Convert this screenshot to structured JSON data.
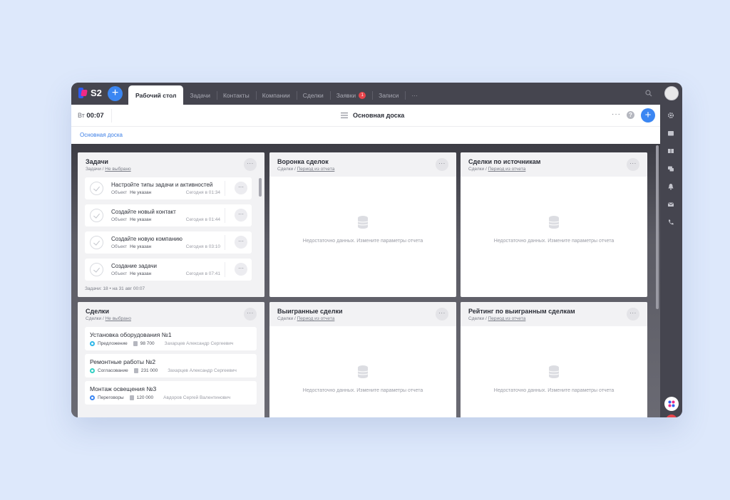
{
  "app": {
    "logo_text": "S2",
    "plus_label": "+",
    "tabs": [
      {
        "label": "Рабочий стол",
        "active": true
      },
      {
        "label": "Задачи"
      },
      {
        "label": "Контакты"
      },
      {
        "label": "Компании"
      },
      {
        "label": "Сделки"
      },
      {
        "label": "Заявки",
        "badge": "1"
      },
      {
        "label": "Записи"
      },
      {
        "label": "···"
      }
    ]
  },
  "header": {
    "day": "Вт",
    "time": "00:07",
    "board_title": "Основная доска",
    "more": "···",
    "help": "?",
    "plus": "+"
  },
  "breadcrumb": "Основная доска",
  "widgets": {
    "tasks": {
      "title": "Задачи",
      "sub_prefix": "Задачи / ",
      "sub_link": "Не выбрано",
      "more": "···",
      "items": [
        {
          "title": "Настройте типы задачи и активностей",
          "object_label": "Объект",
          "object_value": "Не указан",
          "time": "Сегодня в 01:34"
        },
        {
          "title": "Создайте новый контакт",
          "object_label": "Объект",
          "object_value": "Не указан",
          "time": "Сегодня в 01:44"
        },
        {
          "title": "Создайте новую компанию",
          "object_label": "Объект",
          "object_value": "Не указан",
          "time": "Сегодня в 03:10"
        },
        {
          "title": "Создание задачи",
          "object_label": "Объект",
          "object_value": "Не указан",
          "time": "Сегодня в 07:41"
        }
      ],
      "footer": "Задачи: 18   •   на 31 авг 00:07"
    },
    "funnel": {
      "title": "Воронка сделок",
      "sub_prefix": "Сделки / ",
      "sub_link": "Период из отчета",
      "more": "···",
      "empty": "Недостаточно данных. Измените параметры отчета"
    },
    "sources": {
      "title": "Сделки по источникам",
      "sub_prefix": "Сделки / ",
      "sub_link": "Период из отчета",
      "more": "···",
      "empty": "Недостаточно данных. Измените параметры отчета"
    },
    "deals": {
      "title": "Сделки",
      "sub_prefix": "Сделки / ",
      "sub_link": "Не выбрано",
      "more": "···",
      "items": [
        {
          "title": "Установка оборудования №1",
          "stage": "Предложение",
          "stage_color": "#2fb7e8",
          "amount": "98 700",
          "owner": "Захарцев Александр Сергеевич"
        },
        {
          "title": "Ремонтные работы №2",
          "stage": "Согласование",
          "stage_color": "#35d0c4",
          "amount": "231 000",
          "owner": "Захарцев Александр Сергеевич"
        },
        {
          "title": "Монтаж освещения №3",
          "stage": "Переговоры",
          "stage_color": "#3b86f2",
          "amount": "120 000",
          "owner": "Авдоров Сергей Валентинович"
        }
      ]
    },
    "won": {
      "title": "Выигранные сделки",
      "sub_prefix": "Сделки / ",
      "sub_link": "Период из отчета",
      "more": "···",
      "empty": "Недостаточно данных. Измените параметры отчета"
    },
    "rating": {
      "title": "Рейтинг по выигранным сделкам",
      "sub_prefix": "Сделки / ",
      "sub_link": "Период из отчета",
      "more": "···",
      "empty": "Недостаточно данных. Измените параметры отчета"
    }
  },
  "rail_icons": [
    "settings-icon",
    "folder-icon",
    "book-icon",
    "chat-icon",
    "bell-icon",
    "mail-icon",
    "phone-icon"
  ],
  "colors": {
    "accent": "#3b86f2",
    "topbar": "#45454f",
    "badge": "#e8444b"
  }
}
